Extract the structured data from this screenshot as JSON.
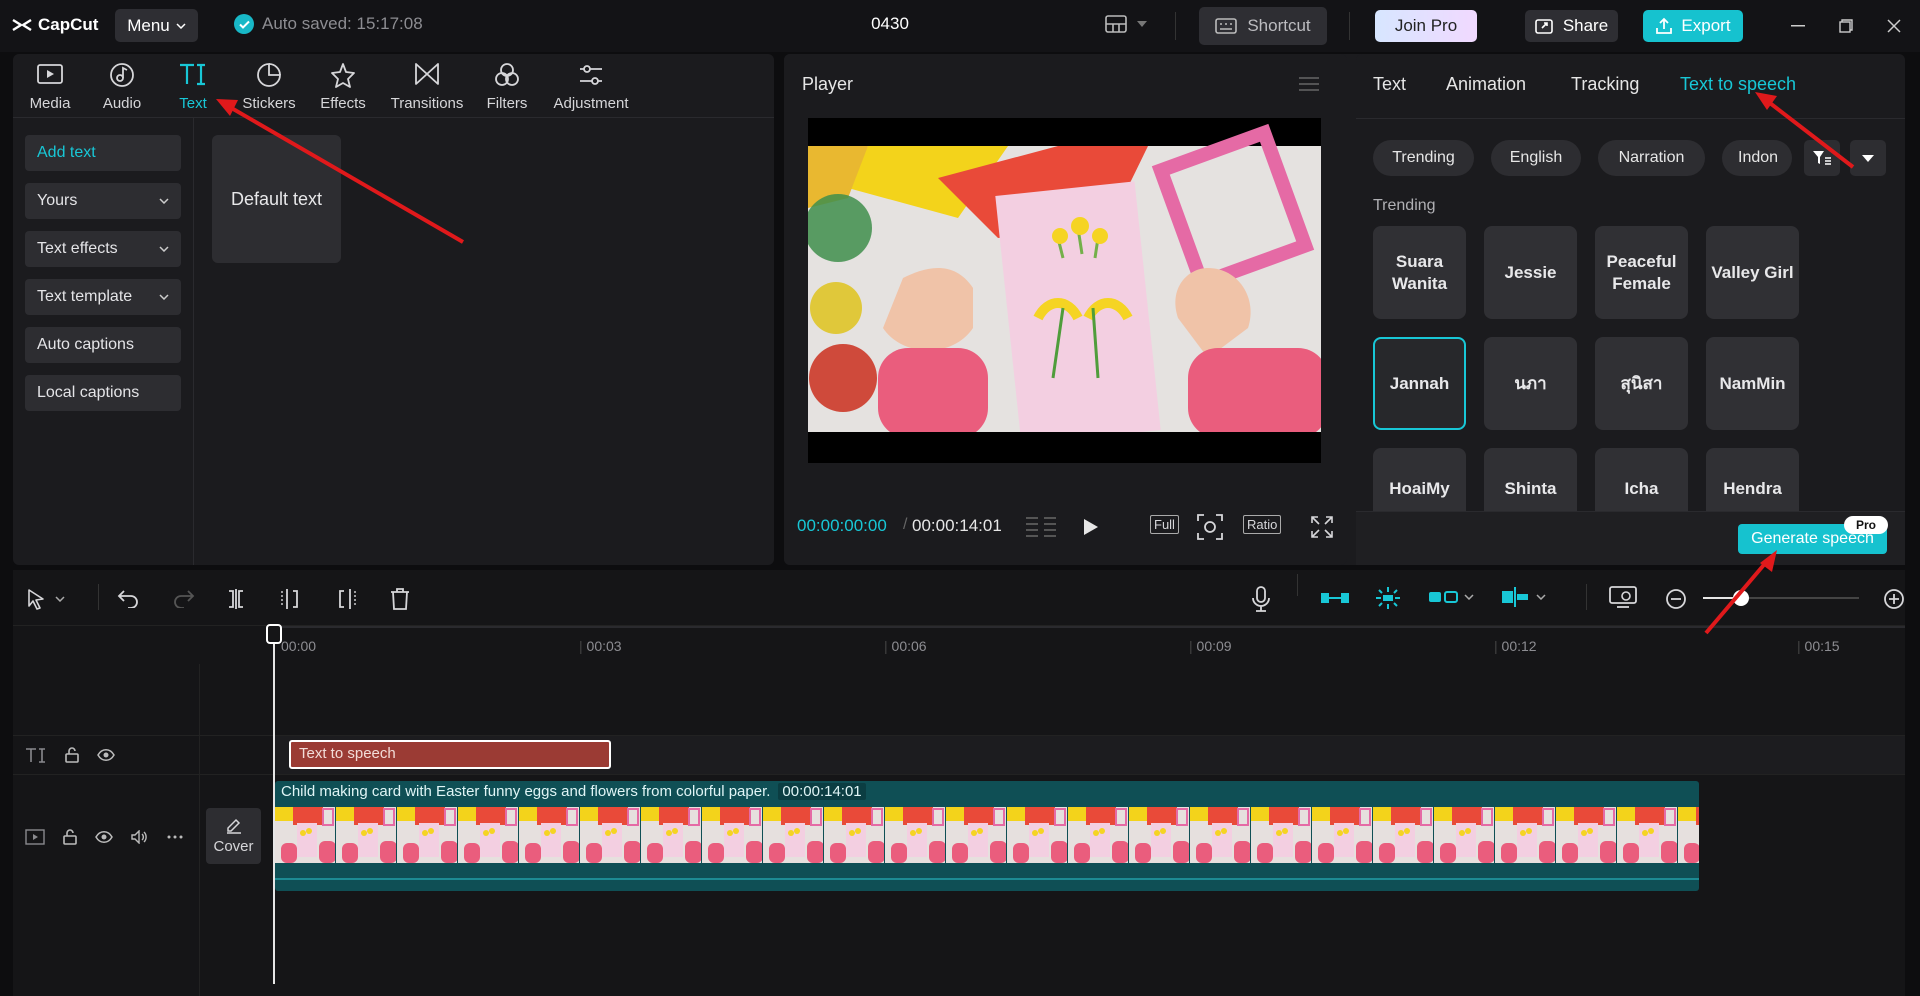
{
  "titlebar": {
    "app_name": "CapCut",
    "menu_label": "Menu",
    "autosave_text": "Auto saved: 15:17:08",
    "project_title": "0430",
    "shortcut_label": "Shortcut",
    "joinpro_label": "Join Pro",
    "share_label": "Share",
    "export_label": "Export"
  },
  "toolbar": {
    "tools": [
      {
        "label": "Media",
        "icon": "media-icon"
      },
      {
        "label": "Audio",
        "icon": "audio-icon"
      },
      {
        "label": "Text",
        "icon": "text-icon",
        "active": true
      },
      {
        "label": "Stickers",
        "icon": "stickers-icon"
      },
      {
        "label": "Effects",
        "icon": "effects-icon"
      },
      {
        "label": "Transitions",
        "icon": "transitions-icon"
      },
      {
        "label": "Filters",
        "icon": "filters-icon"
      },
      {
        "label": "Adjustment",
        "icon": "adjustment-icon"
      }
    ]
  },
  "sidebar": {
    "items": [
      {
        "label": "Add text",
        "active": true
      },
      {
        "label": "Yours",
        "dropdown": true
      },
      {
        "label": "Text effects",
        "dropdown": true
      },
      {
        "label": "Text template",
        "dropdown": true
      },
      {
        "label": "Auto captions"
      },
      {
        "label": "Local captions"
      }
    ]
  },
  "content": {
    "default_text_card": "Default text"
  },
  "player": {
    "title": "Player",
    "current_time": "00:00:00:00",
    "total_time": "00:00:14:01",
    "full_label": "Full",
    "ratio_label": "Ratio"
  },
  "right_panel": {
    "tabs": [
      "Text",
      "Animation",
      "Tracking",
      "Text to speech"
    ],
    "active_tab": "Text to speech",
    "chips": [
      "Trending",
      "English",
      "Narration",
      "Indon"
    ],
    "section_label": "Trending",
    "voices": [
      [
        "Suara Wanita",
        "Jessie",
        "Peaceful Female",
        "Valley Girl"
      ],
      [
        "Jannah",
        "นภา",
        "สุนิสา",
        "NamMin"
      ],
      [
        "HoaiMy",
        "Shinta",
        "Icha",
        "Hendra"
      ]
    ],
    "selected_voice": "Jannah",
    "generate_label": "Generate speech",
    "pro_badge": "Pro"
  },
  "timeline": {
    "ruler": [
      "00:00",
      "00:03",
      "00:06",
      "00:09",
      "00:12",
      "00:15"
    ],
    "tts_clip_label": "Text to speech",
    "video_clip_label": "Child making card with Easter funny eggs and flowers  from colorful paper.",
    "video_clip_duration": "00:00:14:01",
    "cover_label": "Cover"
  },
  "colors": {
    "accent": "#18c7d6",
    "export": "#16c2cf",
    "tts_clip": "#9b3b34",
    "video_clip": "#0f4f55",
    "annotation_arrow": "#e0191b"
  }
}
